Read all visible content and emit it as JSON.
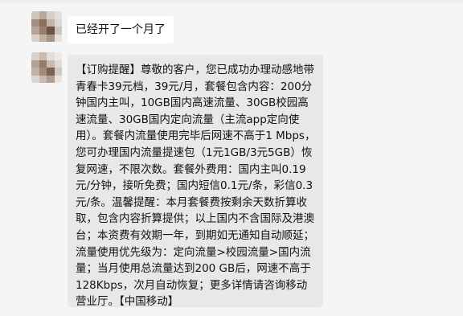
{
  "messages": [
    {
      "sender": "other",
      "text": "已经开了一个月了"
    },
    {
      "sender": "other",
      "text": "【订购提醒】尊敬的客户，您已成功办理动感地带青春卡39元档，39元/月，套餐包含内容：200分钟国内主叫，10GB国内高速流量、30GB校园高速流量、30GB国内定向流量（主流app定向使用）。套餐内流量使用完毕后网速不高于1 Mbps，您可办理国内流量提速包（1元1GB/3元5GB）恢复网速，不限次数。套餐外费用：国内主叫0.19元/分钟，接听免费；国内短信0.1元/条，彩信0.3元/条。温馨提醒：本月套餐费按剩余天数折算收取，包含内容折算提供；以上国内不含国际及港澳台；本资费有效期一年，到期如无通知自动顺延；流量使用优先级为：定向流量>校园流量>国内流量；当月使用总流量达到200 GB后，网速不高于128Kbps，次月自动恢复；更多详情请咨询移动营业厅。【中国移动】"
    }
  ],
  "colors": {
    "background": "#f5f5f5",
    "bubble_white": "#ffffff",
    "bubble_grey": "#e8e8e8",
    "text": "#111111"
  }
}
